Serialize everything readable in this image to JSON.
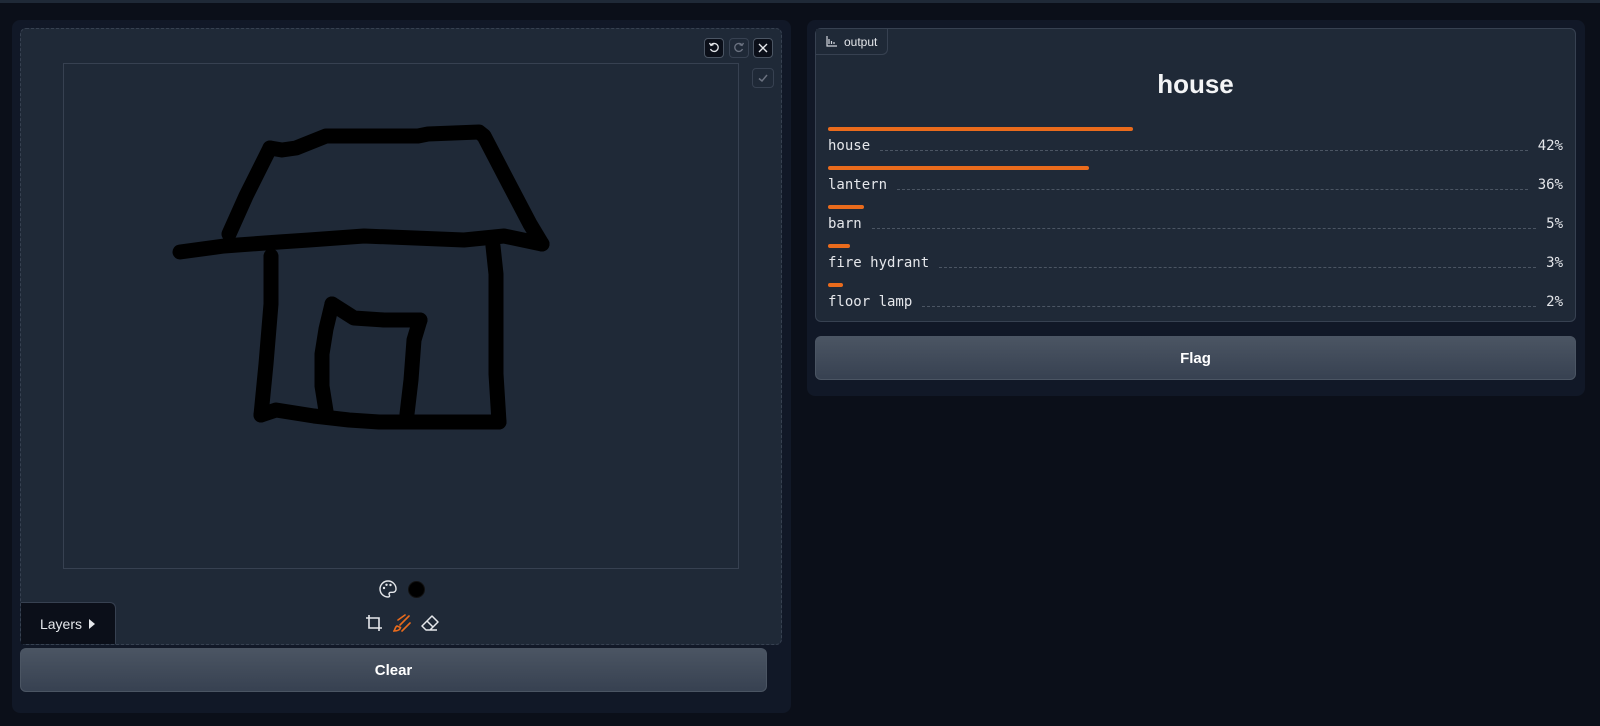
{
  "input": {
    "layers_label": "Layers",
    "clear_label": "Clear",
    "brush_color": "#000000"
  },
  "output": {
    "tag_label": "output",
    "top_label": "house",
    "accent_color": "#ea6b1c",
    "confidences": [
      {
        "label": "house",
        "percent": "42%",
        "value": 0.42
      },
      {
        "label": "lantern",
        "percent": "36%",
        "value": 0.36
      },
      {
        "label": "barn",
        "percent": "5%",
        "value": 0.05
      },
      {
        "label": "fire hydrant",
        "percent": "3%",
        "value": 0.03
      },
      {
        "label": "floor lamp",
        "percent": "2%",
        "value": 0.02
      }
    ]
  },
  "flag_label": "Flag"
}
